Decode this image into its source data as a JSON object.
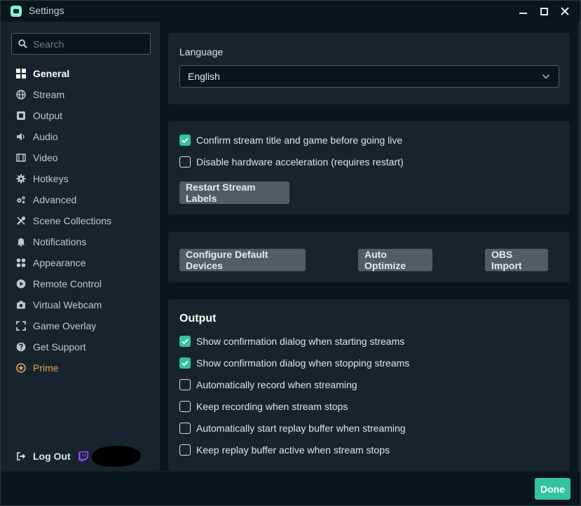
{
  "window": {
    "title": "Settings"
  },
  "sidebar": {
    "search_placeholder": "Search",
    "items": [
      {
        "label": "General",
        "icon": "grid-icon"
      },
      {
        "label": "Stream",
        "icon": "globe-icon"
      },
      {
        "label": "Output",
        "icon": "output-icon"
      },
      {
        "label": "Audio",
        "icon": "speaker-icon"
      },
      {
        "label": "Video",
        "icon": "film-icon"
      },
      {
        "label": "Hotkeys",
        "icon": "gear-icon"
      },
      {
        "label": "Advanced",
        "icon": "gears-icon"
      },
      {
        "label": "Scene Collections",
        "icon": "tools-icon"
      },
      {
        "label": "Notifications",
        "icon": "bell-icon"
      },
      {
        "label": "Appearance",
        "icon": "palette-icon"
      },
      {
        "label": "Remote Control",
        "icon": "play-circle-icon"
      },
      {
        "label": "Virtual Webcam",
        "icon": "camera-icon"
      },
      {
        "label": "Game Overlay",
        "icon": "expand-icon"
      },
      {
        "label": "Get Support",
        "icon": "question-icon"
      },
      {
        "label": "Prime",
        "icon": "star-badge-icon"
      }
    ],
    "logout_label": "Log Out"
  },
  "language": {
    "label": "Language",
    "selected": "English"
  },
  "general": {
    "options": [
      {
        "label": "Confirm stream title and game before going live",
        "checked": true
      },
      {
        "label": "Disable hardware acceleration (requires restart)",
        "checked": false
      }
    ],
    "restart_button": "Restart Stream Labels"
  },
  "actions": {
    "configure_devices": "Configure Default Devices",
    "auto_optimize": "Auto Optimize",
    "obs_import": "OBS Import"
  },
  "output": {
    "title": "Output",
    "options": [
      {
        "label": "Show confirmation dialog when starting streams",
        "checked": true
      },
      {
        "label": "Show confirmation dialog when stopping streams",
        "checked": true
      },
      {
        "label": "Automatically record when streaming",
        "checked": false
      },
      {
        "label": "Keep recording when stream stops",
        "checked": false
      },
      {
        "label": "Automatically start replay buffer when streaming",
        "checked": false
      },
      {
        "label": "Keep replay buffer active when stream stops",
        "checked": false
      }
    ]
  },
  "footer": {
    "done_label": "Done"
  },
  "colors": {
    "accent": "#31c3a2",
    "prime": "#e3a758",
    "twitch": "#9147ff",
    "panel": "#17242d",
    "background": "#09161d"
  }
}
